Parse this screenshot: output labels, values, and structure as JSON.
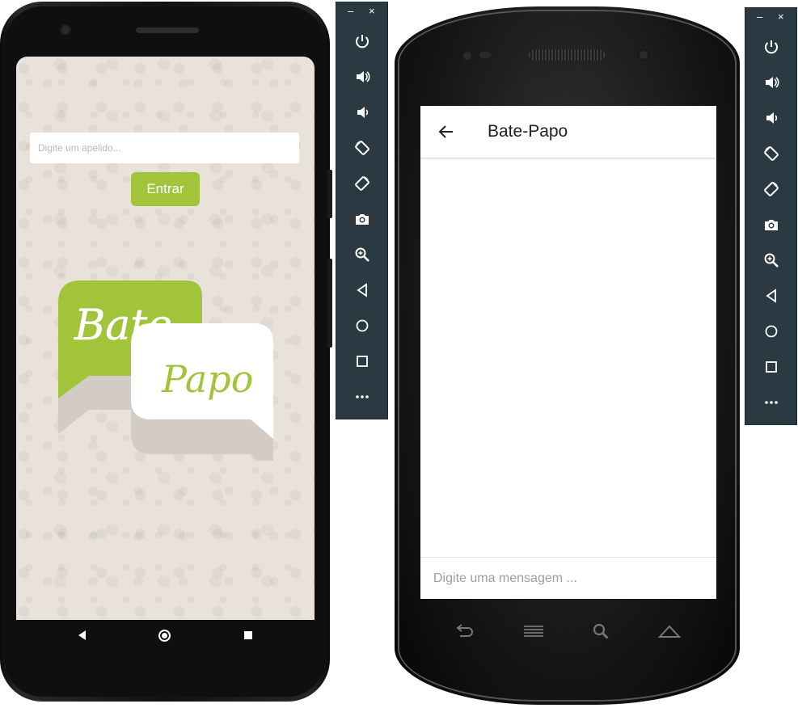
{
  "left_device": {
    "nickname_placeholder": "Digite um apelido...",
    "enter_label": "Entrar",
    "logo": {
      "word1": "Bate",
      "word2": "Papo",
      "accent": "#a2c43a"
    }
  },
  "left_toolbar": {
    "minimize": "–",
    "close": "×"
  },
  "right_device": {
    "appbar_title": "Bate-Papo",
    "message_placeholder": "Digite uma mensagem ..."
  },
  "right_toolbar": {
    "minimize": "–",
    "close": "×"
  },
  "toolbar_icons": [
    "power-icon",
    "volume-up-icon",
    "volume-down-icon",
    "rotate-left-icon",
    "rotate-right-icon",
    "camera-icon",
    "zoom-icon",
    "back-icon",
    "home-icon",
    "overview-icon",
    "more-icon"
  ],
  "colors": {
    "accent_green": "#a2c43a",
    "toolbar_bg": "#2b3a42",
    "chat_bg": "#e8e2db"
  }
}
